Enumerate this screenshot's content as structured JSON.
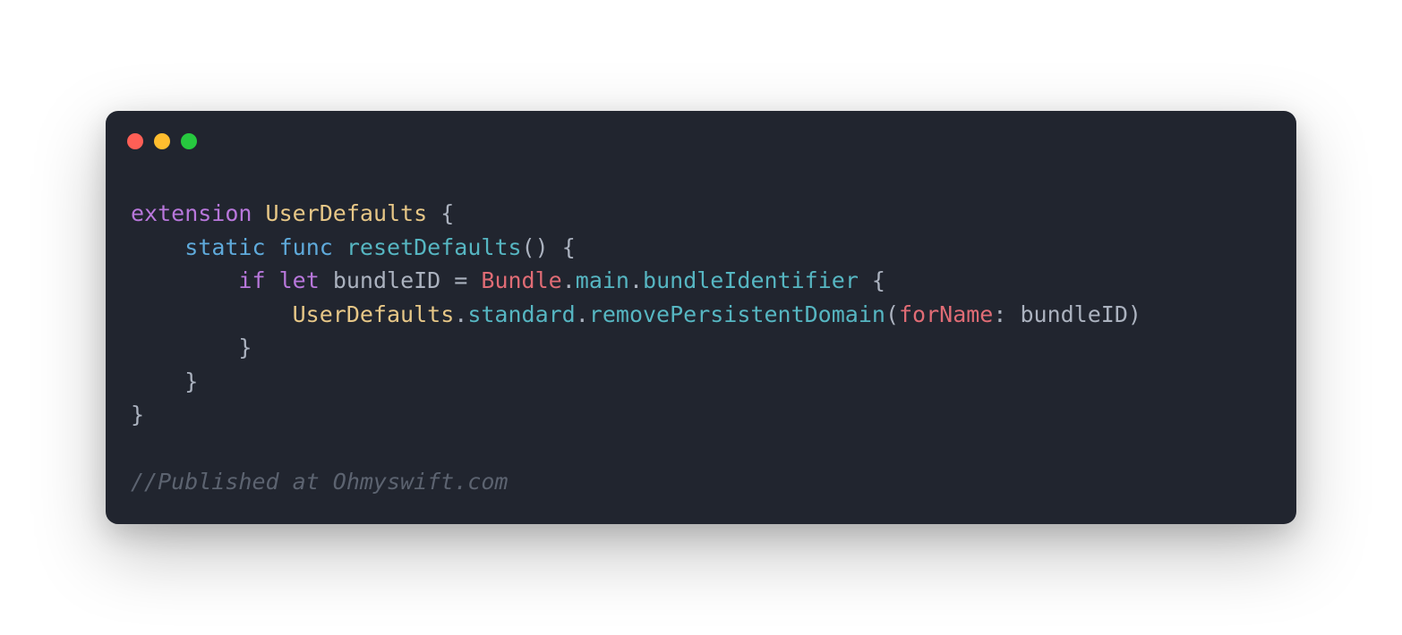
{
  "colors": {
    "windowBg": "#21252f",
    "red": "#ff5f56",
    "yellow": "#ffbd2e",
    "green": "#27c93f",
    "keyword": "#b877db",
    "keywordBlue": "#5faadb",
    "type": "#e7c787",
    "func": "#56b6c2",
    "param": "#e06c75",
    "identifier": "#abb2bf",
    "comment": "#5c6370"
  },
  "code": {
    "l1": {
      "extension": "extension",
      "UserDefaults": "UserDefaults",
      "brace": " {"
    },
    "l2": {
      "indent": "    ",
      "static": "static",
      "sp": " ",
      "func": "func",
      "sp2": " ",
      "resetDefaults": "resetDefaults",
      "parens": "()",
      "brace": " {"
    },
    "l3": {
      "indent": "        ",
      "if": "if",
      "sp": " ",
      "let": "let",
      "sp2": " ",
      "bundleID": "bundleID",
      "eq": " = ",
      "Bundle": "Bundle",
      "dot1": ".",
      "main": "main",
      "dot2": ".",
      "bundleIdentifier": "bundleIdentifier",
      "brace": " {"
    },
    "l4": {
      "indent": "            ",
      "UserDefaults": "UserDefaults",
      "dot1": ".",
      "standard": "standard",
      "dot2": ".",
      "removePersistentDomain": "removePersistentDomain",
      "paren1": "(",
      "forName": "forName",
      "colon": ": ",
      "bundleID": "bundleID",
      "paren2": ")"
    },
    "l5": {
      "indent": "        ",
      "brace": "}"
    },
    "l6": {
      "indent": "    ",
      "brace": "}"
    },
    "l7": {
      "brace": "}"
    },
    "blank": "",
    "l8": {
      "comment": "//Published at Ohmyswift.com"
    }
  }
}
